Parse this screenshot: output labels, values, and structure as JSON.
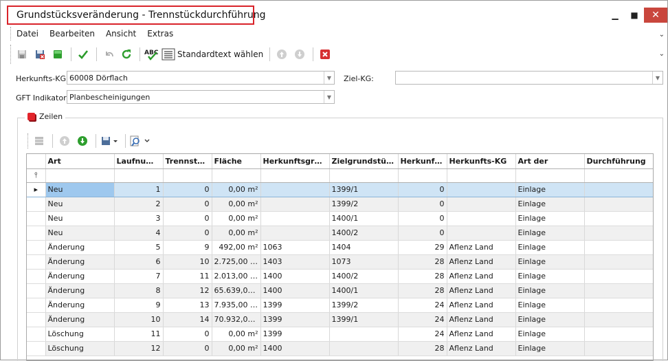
{
  "window": {
    "title": "Grundstücksveränderung - Trennstückdurchführung",
    "minimize": "▁",
    "maximize": "■",
    "close": "✕"
  },
  "menu": [
    "Datei",
    "Bearbeiten",
    "Ansicht",
    "Extras"
  ],
  "toolbar": {
    "standardtext_label": "Standardtext wählen"
  },
  "form": {
    "herkunft_label": "Herkunfts-KG:",
    "herkunft_value": "60008 Dörflach",
    "ziel_label": "Ziel-KG:",
    "ziel_value": "",
    "gft_label": "GFT Indikator:",
    "gft_value": "Planbescheinigungen"
  },
  "zeilen": {
    "label": "Zeilen"
  },
  "grid": {
    "columns": [
      "Art",
      "Laufnum…",
      "Trennstü…",
      "Fläche",
      "Herkunftsgrun…",
      "Zielgrundstüc…",
      "Herkunft…",
      "Herkunfts-KG",
      "Art der",
      "Durchführung"
    ],
    "filter_icon": "⫯",
    "row_indicator": "▸",
    "rows": [
      [
        "Neu",
        "1",
        "0",
        "0,00 m²",
        "",
        "1399/1",
        "0",
        "",
        "Einlage",
        ""
      ],
      [
        "Neu",
        "2",
        "0",
        "0,00 m²",
        "",
        "1399/2",
        "0",
        "",
        "Einlage",
        ""
      ],
      [
        "Neu",
        "3",
        "0",
        "0,00 m²",
        "",
        "1400/1",
        "0",
        "",
        "Einlage",
        ""
      ],
      [
        "Neu",
        "4",
        "0",
        "0,00 m²",
        "",
        "1400/2",
        "0",
        "",
        "Einlage",
        ""
      ],
      [
        "Änderung",
        "5",
        "9",
        "492,00 m²",
        "1063",
        "1404",
        "29",
        "Aflenz Land",
        "Einlage",
        ""
      ],
      [
        "Änderung",
        "6",
        "10",
        "2.725,00 m²",
        "1403",
        "1073",
        "28",
        "Aflenz Land",
        "Einlage",
        ""
      ],
      [
        "Änderung",
        "7",
        "11",
        "2.013,00 m²",
        "1400",
        "1400/2",
        "28",
        "Aflenz Land",
        "Einlage",
        ""
      ],
      [
        "Änderung",
        "8",
        "12",
        "65.639,00 …",
        "1400",
        "1400/1",
        "28",
        "Aflenz Land",
        "Einlage",
        ""
      ],
      [
        "Änderung",
        "9",
        "13",
        "7.935,00 m²",
        "1399",
        "1399/2",
        "24",
        "Aflenz Land",
        "Einlage",
        ""
      ],
      [
        "Änderung",
        "10",
        "14",
        "70.932,00 …",
        "1399",
        "1399/1",
        "24",
        "Aflenz Land",
        "Einlage",
        ""
      ],
      [
        "Löschung",
        "11",
        "0",
        "0,00 m²",
        "1399",
        "",
        "24",
        "Aflenz Land",
        "Einlage",
        ""
      ],
      [
        "Löschung",
        "12",
        "0",
        "0,00 m²",
        "1400",
        "",
        "28",
        "Aflenz Land",
        "Einlage",
        ""
      ]
    ]
  },
  "colors": {
    "accent_red": "#e2242b",
    "selection": "#cfe4f5",
    "alt_row": "#f0f0f0"
  }
}
